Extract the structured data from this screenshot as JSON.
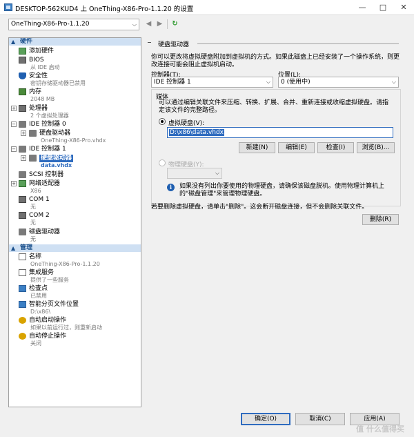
{
  "window": {
    "title": "DESKTOP-562KUD4 上 OneThing-X86-Pro-1.1.20 的设置",
    "minimize": "—",
    "maximize": "□",
    "close": "✕"
  },
  "toolbar": {
    "vm_selected": "OneThing-X86-Pro-1.1.20",
    "back_glyph": "◀",
    "forward_glyph": "▶",
    "refresh_glyph": "↻"
  },
  "tree": {
    "hardware_header": "硬件",
    "manage_header": "管理",
    "expanded_glyph": "▲",
    "plus": "+",
    "minus": "−",
    "items": {
      "add_hardware": {
        "label": "添加硬件"
      },
      "bios": {
        "label": "BIOS",
        "sub": "从 IDE 启动"
      },
      "security": {
        "label": "安全性",
        "sub": "密钥存储驱动器已禁用"
      },
      "memory": {
        "label": "内存",
        "sub": "2048 MB"
      },
      "processor": {
        "label": "处理器",
        "sub": "2 个虚拟处理器"
      },
      "ide0": {
        "label": "IDE 控制器 0"
      },
      "ide0_disk": {
        "label": "硬盘驱动器",
        "sub": "OneThing-X86-Pro.vhdx"
      },
      "ide1": {
        "label": "IDE 控制器 1"
      },
      "ide1_disk": {
        "label": "硬盘驱动器",
        "sub": "data.vhdx"
      },
      "scsi": {
        "label": "SCSI 控制器"
      },
      "network": {
        "label": "网络适配器",
        "sub": "X86"
      },
      "com1": {
        "label": "COM 1",
        "sub": "无"
      },
      "com2": {
        "label": "COM 2",
        "sub": "无"
      },
      "floppy": {
        "label": "磁盘驱动器",
        "sub": "无"
      },
      "name": {
        "label": "名称",
        "sub": "OneThing-X86-Pro-1.1.20"
      },
      "integration": {
        "label": "集成服务",
        "sub": "提供了一些服务"
      },
      "checkpoints": {
        "label": "检查点",
        "sub": "已禁用"
      },
      "paging": {
        "label": "智能分页文件位置",
        "sub": "D:\\x86\\"
      },
      "autostart": {
        "label": "自动启动操作",
        "sub": "如果以前运行过，则重新启动"
      },
      "autostop": {
        "label": "自动停止操作",
        "sub": "关闭"
      }
    }
  },
  "page": {
    "title": "硬盘驱动器",
    "description": "你可以更改将虚拟硬盘附加到虚拟机的方式。如果此磁盘上已经安装了一个操作系统，则更改连接可能会阻止虚拟机启动。",
    "controller_label": "控制器(T):",
    "controller_value": "IDE 控制器 1",
    "location_label": "位置(L):",
    "location_value": "0 (使用中)",
    "media_title": "媒体",
    "media_desc": "可以通过编辑关联文件来压缩、转换、扩展、合并、重新连接或收缩虚拟硬盘。请指定该文件的完整路径。",
    "virtual_disk_label": "虚拟硬盘(V):",
    "virtual_disk_path": "D:\\x86\\data.vhdx",
    "btn_new": "新建(N)",
    "btn_edit": "编辑(E)",
    "btn_inspect": "检查(I)",
    "btn_browse": "浏览(B)...",
    "physical_disk_label": "物理硬盘(Y):",
    "info_glyph": "i",
    "info_text": "如果没有列出你要使用的物理硬盘，请确保该磁盘脱机。使用物理计算机上的\"磁盘管理\"来管理物理硬盘。",
    "delete_hint": "若要删除虚拟硬盘，请单击\"删除\"。这会断开磁盘连接，但不会删除关联文件。",
    "btn_delete": "删除(R)"
  },
  "footer": {
    "ok": "确定(O)",
    "cancel": "取消(C)",
    "apply": "应用(A)",
    "watermark": "值 什么值得买"
  }
}
